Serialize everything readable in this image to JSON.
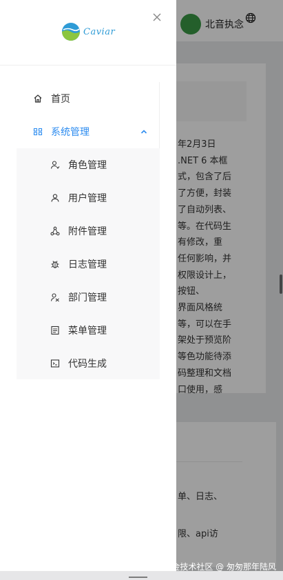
{
  "background": {
    "user": {
      "name": "北音执念"
    },
    "article_lines": [
      "年2月3日",
      ".NET 6 本框",
      "式，包含了后",
      "了方便，封装",
      "了自动列表、",
      "等。在代码生",
      "有修改，重",
      "任何影响，并",
      "权限设计上，",
      "按钮、",
      "界面风格统",
      "等，可以在手",
      "架处于预览阶",
      "等色功能待添",
      "码整理和文档",
      "口使用，感"
    ],
    "card2_lines": [
      "单、日志、",
      "限、api访"
    ],
    "watermark": "掘金技术社区 @ 匆匆那年陆风"
  },
  "drawer": {
    "logo_text": "Caviar",
    "menu": {
      "home": "首页",
      "system": "系统管理",
      "sub_items": [
        {
          "label": "角色管理",
          "icon": "role-icon"
        },
        {
          "label": "用户管理",
          "icon": "user-icon"
        },
        {
          "label": "附件管理",
          "icon": "attachment-icon"
        },
        {
          "label": "日志管理",
          "icon": "bug-icon"
        },
        {
          "label": "部门管理",
          "icon": "department-icon"
        },
        {
          "label": "菜单管理",
          "icon": "menu-list-icon"
        },
        {
          "label": "代码生成",
          "icon": "terminal-icon"
        }
      ]
    }
  },
  "colors": {
    "accent": "#2d8cf0",
    "logo": "#2e9bd6"
  }
}
